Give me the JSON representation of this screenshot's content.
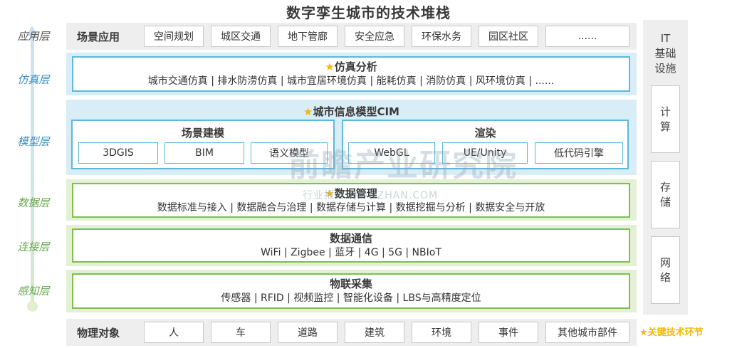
{
  "title": "数字孪生城市的技术堆栈",
  "layers": {
    "app": "应用层",
    "sim": "仿真层",
    "model": "模型层",
    "data": "数据层",
    "conn": "连接层",
    "sense": "感知层"
  },
  "scene_app": {
    "title": "场景应用",
    "items": [
      "空间规划",
      "城区交通",
      "地下管廊",
      "安全应急",
      "环保水务",
      "园区社区",
      "......"
    ]
  },
  "simulation": {
    "star": "★",
    "title": "仿真分析",
    "subtitle": "城市交通仿真 | 排水防涝仿真 | 城市宜居环境仿真 | 能耗仿真 | 消防仿真 | 风环境仿真 | ......"
  },
  "cim": {
    "star": "★",
    "title": "城市信息模型CIM",
    "scene_modeling": {
      "title": "场景建模",
      "items": [
        "3DGIS",
        "BIM",
        "语义模型"
      ]
    },
    "rendering": {
      "title": "渲染",
      "items": [
        "WebGL",
        "UE/Unity",
        "低代码引擎"
      ]
    }
  },
  "data_mgmt": {
    "star": "★",
    "title": "数据管理",
    "subtitle": "数据标准与接入 | 数据融合与治理 | 数据存储与计算 | 数据挖掘与分析 | 数据安全与开放"
  },
  "data_comm": {
    "title": "数据通信",
    "subtitle": "WiFi | Zigbee | 蓝牙 | 4G | 5G | NBIoT"
  },
  "iot": {
    "title": "物联采集",
    "subtitle": "传感器 | RFID | 视频监控 | 智能化设备 | LBS与高精度定位"
  },
  "physical": {
    "title": "物理对象",
    "items": [
      "人",
      "车",
      "道路",
      "建筑",
      "环境",
      "事件",
      "其他城市部件"
    ]
  },
  "it_infra": {
    "title_lines": [
      "IT",
      "基础",
      "设施"
    ],
    "items": [
      "计算",
      "存储",
      "网络"
    ]
  },
  "legend": "★关键技术环节",
  "watermark": {
    "main": "前瞻产业研究院",
    "sub": "行业报告  QIANZHAN.COM"
  },
  "colors": {
    "blue_border": "#5bb8de",
    "green_border": "#7cc04a",
    "star": "#f5b800"
  }
}
